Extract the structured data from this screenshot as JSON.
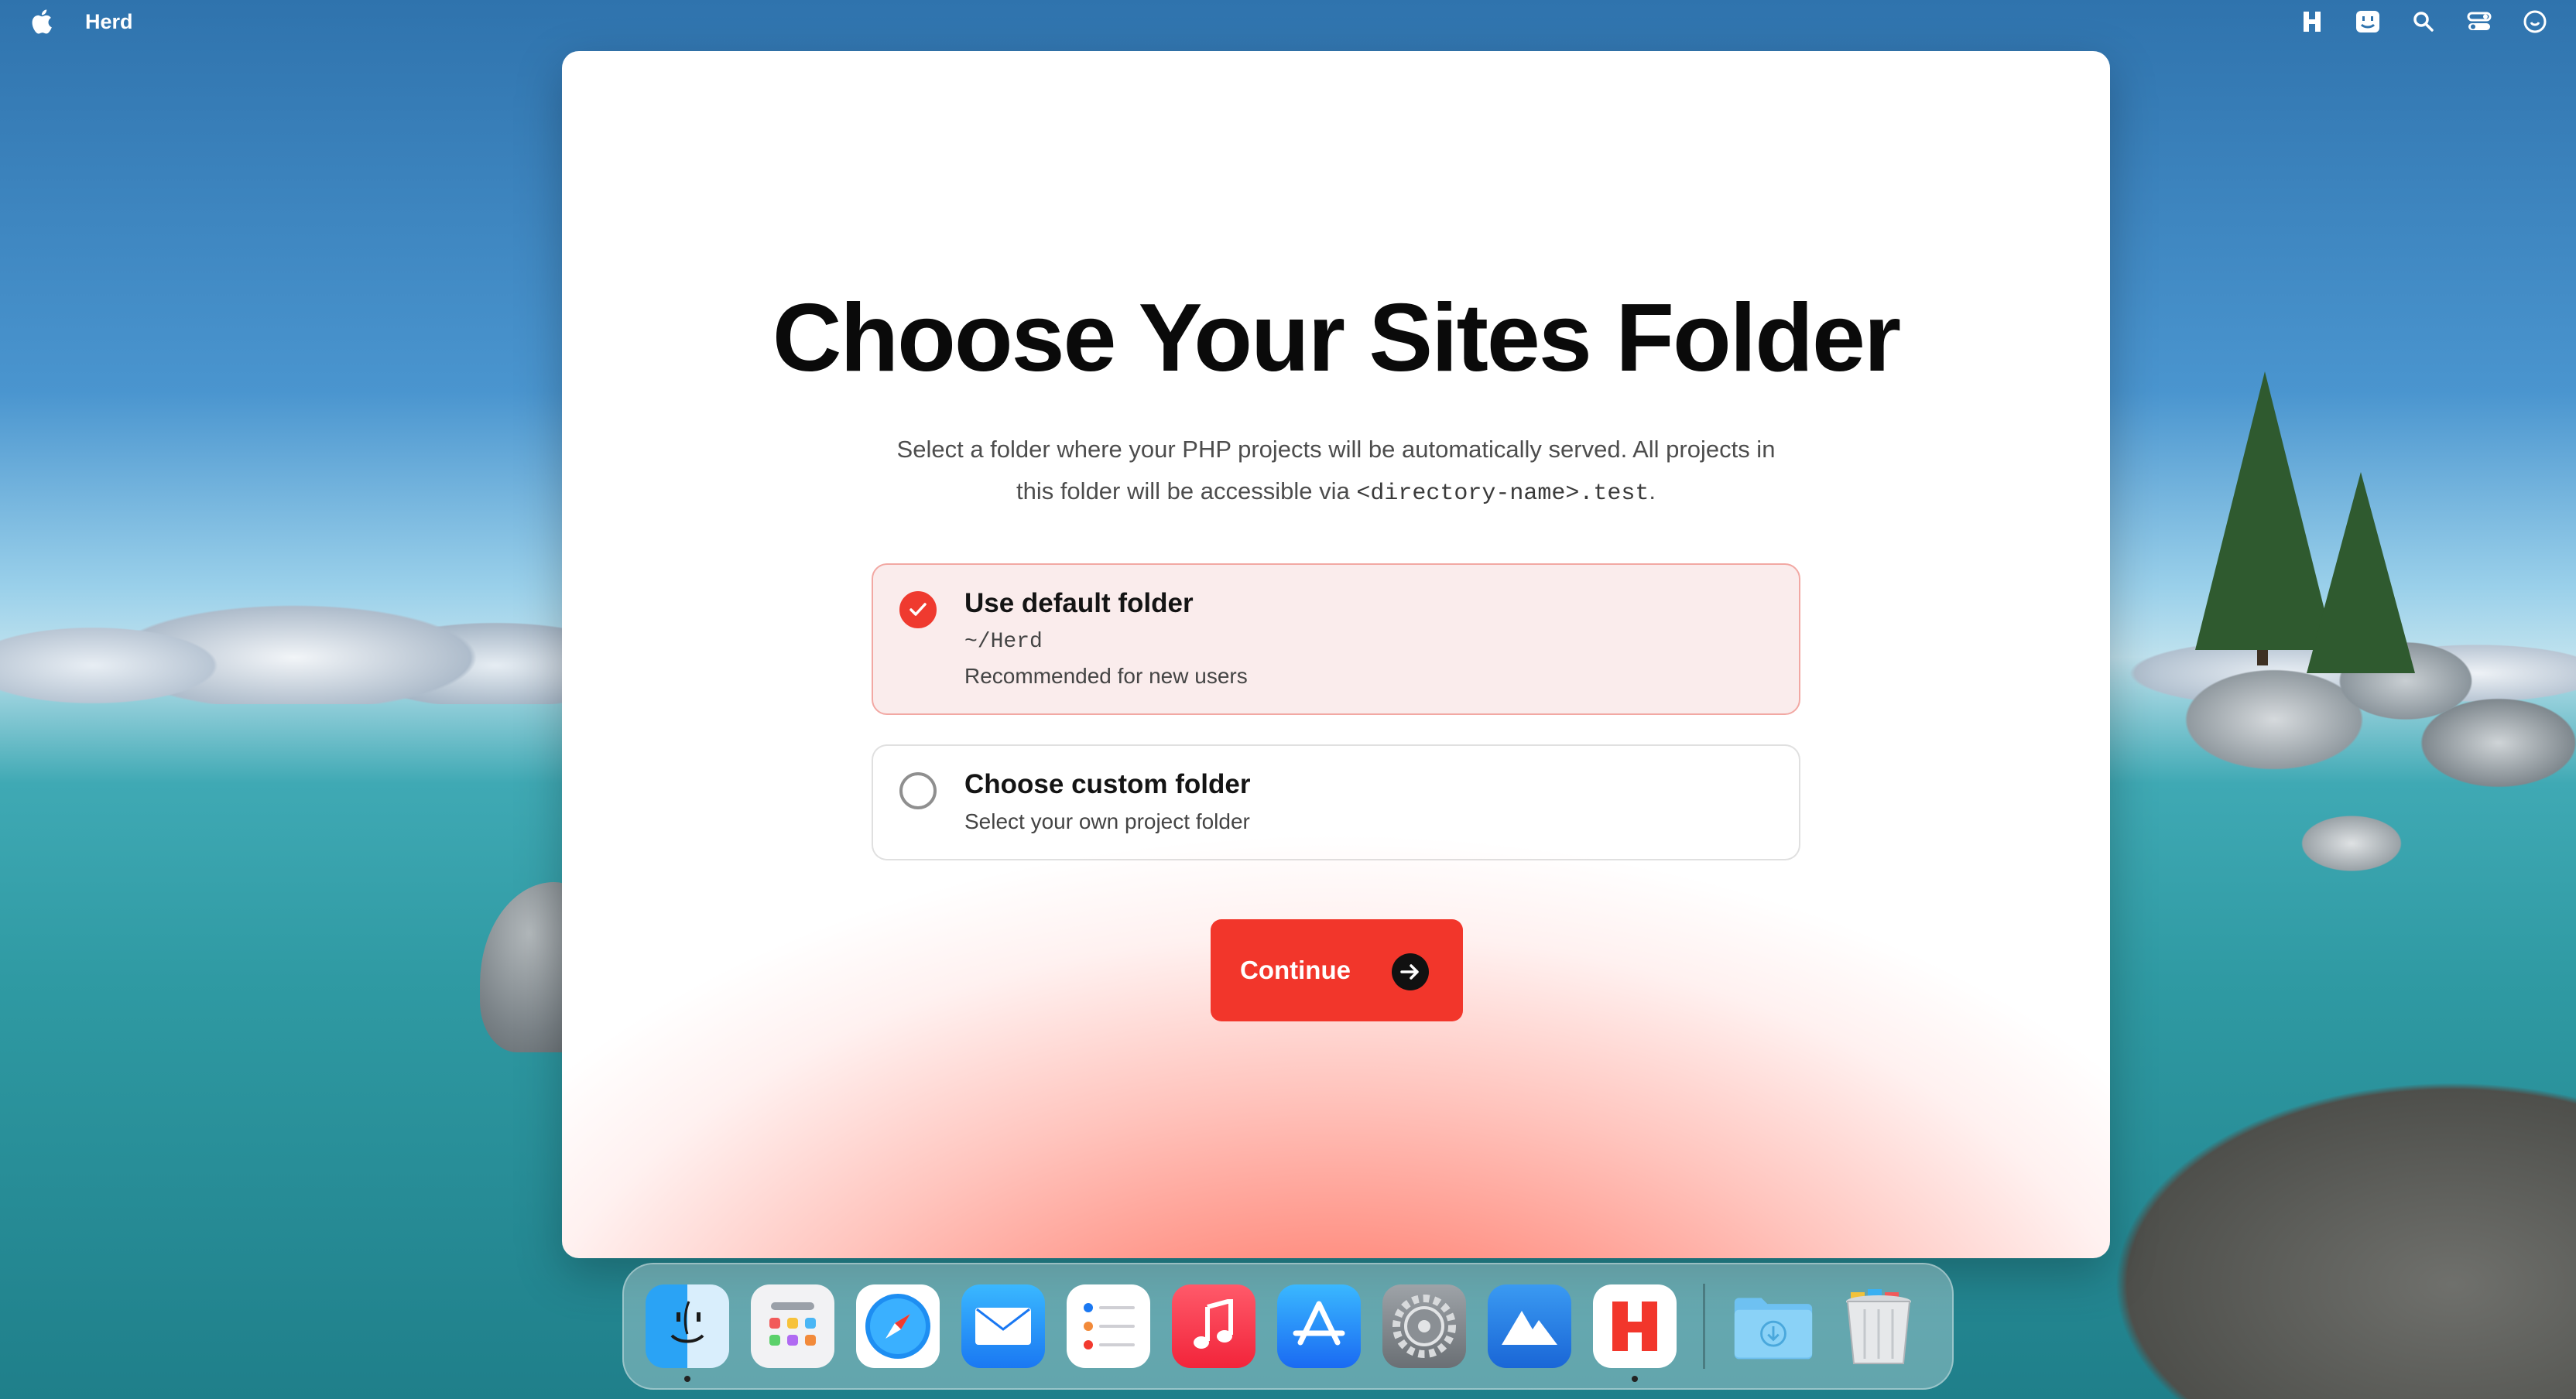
{
  "menubar": {
    "app_name": "Herd",
    "icons": [
      "apple-icon",
      "herd-menu-icon",
      "finder-face-icon",
      "search-icon",
      "control-center-icon",
      "user-icon"
    ]
  },
  "dialog": {
    "title": "Choose Your Sites Folder",
    "subtitle_line1": "Select a folder where your PHP projects will be automatically served. All projects in",
    "subtitle_line2_prefix": "this folder will be accessible via ",
    "subtitle_code": "<directory-name>.test",
    "subtitle_line2_suffix": ".",
    "options": [
      {
        "label": "Use default folder",
        "path": "~/Herd",
        "description": "Recommended for new users",
        "selected": true
      },
      {
        "label": "Choose custom folder",
        "description": "Select your own project folder",
        "selected": false
      }
    ],
    "continue_label": "Continue",
    "accent_color": "#f2362b"
  },
  "dock": {
    "apps": [
      {
        "name": "finder-icon",
        "running": true
      },
      {
        "name": "launchpad-icon",
        "running": false
      },
      {
        "name": "safari-icon",
        "running": false
      },
      {
        "name": "mail-icon",
        "running": false
      },
      {
        "name": "reminders-icon",
        "running": false
      },
      {
        "name": "music-icon",
        "running": false
      },
      {
        "name": "app-store-icon",
        "running": false
      },
      {
        "name": "system-settings-icon",
        "running": false
      },
      {
        "name": "mountain-app-icon",
        "running": false
      },
      {
        "name": "herd-icon",
        "running": true
      },
      {
        "name": "downloads-folder-icon",
        "running": false
      },
      {
        "name": "trash-icon",
        "running": false
      }
    ]
  }
}
